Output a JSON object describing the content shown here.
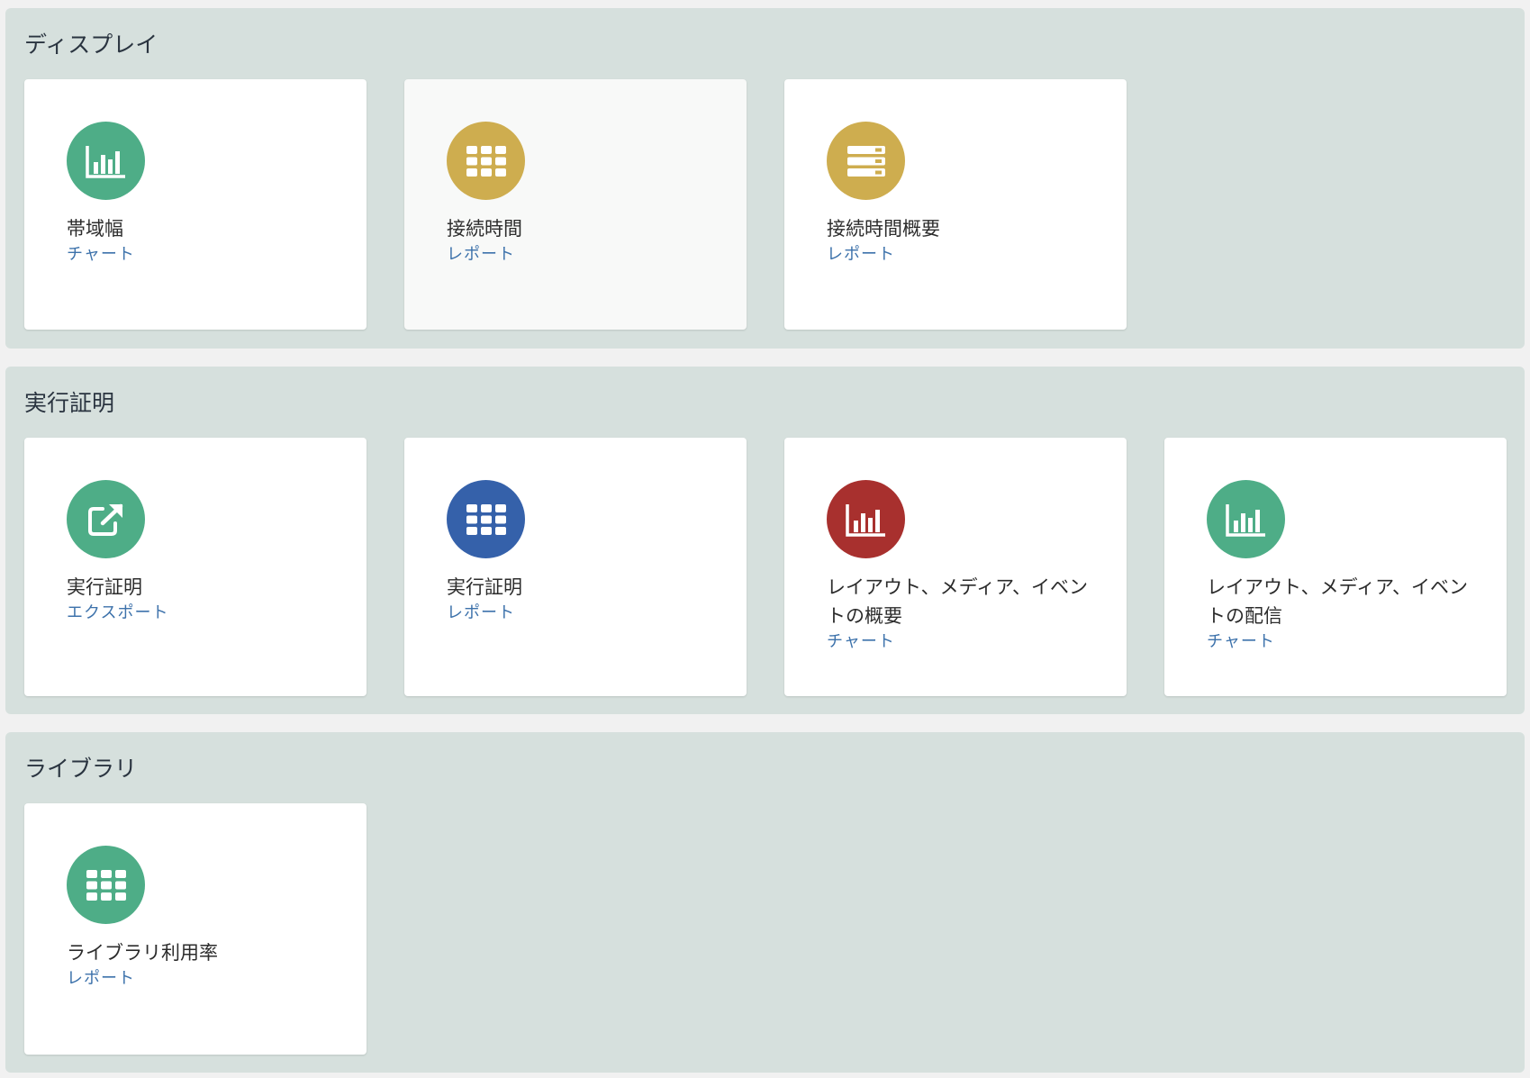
{
  "colors": {
    "green": "#4ead87",
    "gold": "#cead4f",
    "blue": "#3561aa",
    "red": "#a8302e",
    "link": "#3d72ab",
    "section_bg": "#d6e0dd"
  },
  "sections": [
    {
      "title": "ディスプレイ",
      "cards": [
        {
          "title": "帯域幅",
          "type": "チャート",
          "icon": "bar-chart-icon",
          "color": "green"
        },
        {
          "title": "接続時間",
          "type": "レポート",
          "icon": "grid-table-icon",
          "color": "gold"
        },
        {
          "title": "接続時間概要",
          "type": "レポート",
          "icon": "list-rows-icon",
          "color": "gold"
        }
      ]
    },
    {
      "title": "実行証明",
      "cards": [
        {
          "title": "実行証明",
          "type": "エクスポート",
          "icon": "external-export-icon",
          "color": "green"
        },
        {
          "title": "実行証明",
          "type": "レポート",
          "icon": "grid-table-icon",
          "color": "blue"
        },
        {
          "title": "レイアウト、メディア、イベントの概要",
          "type": "チャート",
          "icon": "bar-chart-icon",
          "color": "red"
        },
        {
          "title": "レイアウト、メディア、イベントの配信",
          "type": "チャート",
          "icon": "bar-chart-icon",
          "color": "green"
        }
      ]
    },
    {
      "title": "ライブラリ",
      "cards": [
        {
          "title": "ライブラリ利用率",
          "type": "レポート",
          "icon": "grid-table-icon",
          "color": "green"
        }
      ]
    }
  ]
}
